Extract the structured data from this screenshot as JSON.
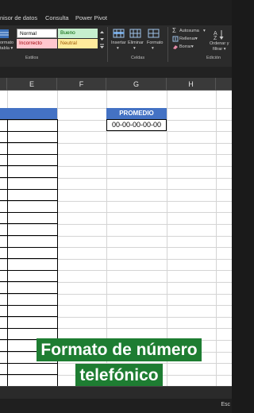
{
  "menu_tabs": [
    "nisor de datos",
    "Consulta",
    "Power Pivot"
  ],
  "ribbon": {
    "format_table_label": "ormato\ntabla",
    "cell_styles": {
      "normal": "Normal",
      "bueno": "Bueno",
      "incorrecto": "Incorrecto",
      "neutral": "Neutral"
    },
    "styles_group": "Estilos",
    "cells": {
      "insert": "Insertar",
      "delete": "Eliminar",
      "format": "Formato",
      "group": "Celdas"
    },
    "editing": {
      "autosum": "Autosuma",
      "fill": "Rellenar",
      "clear": "Borrar",
      "sort_filter": "Ordenar y\nfiltrar",
      "group": "Edición"
    }
  },
  "columns": [
    "E",
    "F",
    "G",
    "H"
  ],
  "sheet": {
    "promedio_header": "PROMEDIO",
    "promedio_value": "00-00-00-00-00"
  },
  "caption": {
    "line1": "Formato de número",
    "line2": "telefónico"
  },
  "status": {
    "text": "Esc"
  },
  "colors": {
    "table_header": "#4472c4",
    "caption_bg": "#1e7d32",
    "bueno_bg": "#c6efce",
    "bueno_fg": "#006100",
    "incorrecto_bg": "#ffc7ce",
    "incorrecto_fg": "#9c0006",
    "neutral_bg": "#ffeb9c",
    "neutral_fg": "#9c5700"
  }
}
